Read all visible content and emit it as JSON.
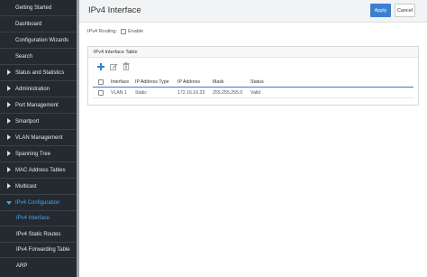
{
  "sidebar": {
    "items": [
      {
        "label": "Getting Started"
      },
      {
        "label": "Dashboard"
      },
      {
        "label": "Configuration Wizards"
      },
      {
        "label": "Search"
      },
      {
        "label": "Status and Statistics"
      },
      {
        "label": "Administration"
      },
      {
        "label": "Port Management"
      },
      {
        "label": "Smartport"
      },
      {
        "label": "VLAN Management"
      },
      {
        "label": "Spanning Tree"
      },
      {
        "label": "MAC Address Tables"
      },
      {
        "label": "Multicast"
      },
      {
        "label": "IPv4 Configuration"
      },
      {
        "label": "IPv4 Interface"
      },
      {
        "label": "IPv4 Static Routes"
      },
      {
        "label": "IPv4 Forwarding Table"
      },
      {
        "label": "ARP"
      }
    ]
  },
  "header": {
    "title": "IPv4 Interface",
    "apply_label": "Apply",
    "cancel_label": "Cancel"
  },
  "routing": {
    "label": "IPv4 Routing:",
    "enable_label": "Enable",
    "enabled": false
  },
  "table": {
    "title": "IPv4 Interface Table",
    "toolbar_icons": [
      "add-icon",
      "edit-icon",
      "delete-icon"
    ],
    "columns": [
      "Interface",
      "IP Address Type",
      "IP Address",
      "Mask",
      "Status"
    ],
    "rows": [
      [
        "VLAN 1",
        "Static",
        "172.16.16.33",
        "255.255.255.0",
        "Valid"
      ]
    ]
  },
  "colors": {
    "sidebar_bg": "#242a30",
    "accent": "#3c7fd1",
    "active_text": "#4aa3e8",
    "add_icon": "#2f7fd4"
  }
}
